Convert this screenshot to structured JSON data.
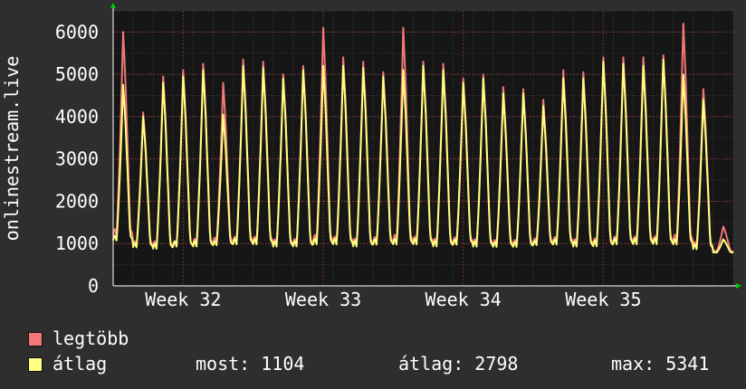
{
  "chart_data": {
    "type": "line",
    "ylabel": "onlinestream.live",
    "ylim": [
      0,
      6500
    ],
    "y_ticks": [
      0,
      1000,
      2000,
      3000,
      4000,
      5000,
      6000
    ],
    "x_ticks": [
      "Week 32",
      "Week 33",
      "Week 34",
      "Week 35"
    ],
    "x_tick_positions_days": [
      3.5,
      10.5,
      17.5,
      24.5
    ],
    "x_range_days": [
      0,
      31
    ],
    "grid": true,
    "days": 31,
    "series": [
      {
        "name": "legtöbb",
        "color": "#f27878",
        "daily_peaks": [
          6000,
          4100,
          4950,
          5100,
          5250,
          4800,
          5350,
          5300,
          5000,
          5200,
          6100,
          5400,
          5300,
          5050,
          6100,
          5300,
          5250,
          4900,
          5000,
          4700,
          4650,
          4400,
          5100,
          5050,
          5400,
          5400,
          5400,
          5450,
          6200,
          4650,
          1400
        ],
        "daily_troughs": [
          1100,
          900,
          850,
          850,
          900,
          950,
          950,
          950,
          900,
          900,
          950,
          950,
          900,
          950,
          950,
          950,
          900,
          950,
          900,
          900,
          900,
          950,
          950,
          900,
          900,
          950,
          950,
          950,
          950,
          850,
          800
        ]
      },
      {
        "name": "átlag",
        "color": "#ffff80",
        "daily_peaks": [
          4750,
          4000,
          4800,
          4950,
          5100,
          4050,
          5200,
          5150,
          4900,
          5100,
          5200,
          5200,
          5150,
          4950,
          5100,
          5200,
          5100,
          4800,
          4900,
          4550,
          4550,
          4250,
          4900,
          4900,
          5300,
          5250,
          5200,
          5350,
          5000,
          4400,
          1100
        ],
        "daily_troughs": [
          1000,
          850,
          800,
          850,
          850,
          900,
          900,
          900,
          850,
          850,
          900,
          900,
          850,
          900,
          900,
          900,
          850,
          900,
          850,
          850,
          850,
          900,
          900,
          850,
          850,
          900,
          900,
          900,
          900,
          800,
          780
        ]
      }
    ]
  },
  "legend": {
    "max_label": "legtöbb",
    "avg_label": "átlag",
    "max_color": "#f27878",
    "avg_color": "#ffff80",
    "most_text": "most: 1104",
    "avg_text": "átlag: 2798",
    "max_text": "max: 5341"
  }
}
